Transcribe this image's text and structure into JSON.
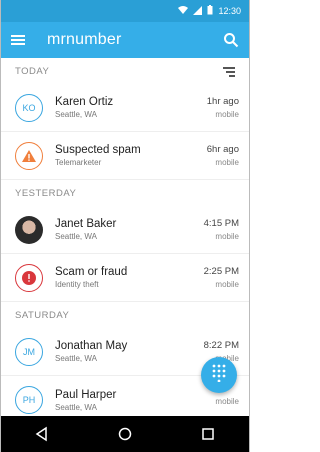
{
  "status": {
    "time": "12:30"
  },
  "appbar": {
    "brand": "mrnumber"
  },
  "sections": {
    "today": "TODAY",
    "yesterday": "YESTERDAY",
    "saturday": "SATURDAY"
  },
  "calls": [
    {
      "initials": "KO",
      "name": "Karen Ortiz",
      "sub": "Seattle, WA",
      "time": "1hr ago",
      "type": "mobile"
    },
    {
      "initials": "",
      "name": "Suspected spam",
      "sub": "Telemarketer",
      "time": "6hr ago",
      "type": "mobile"
    },
    {
      "initials": "",
      "name": "Janet Baker",
      "sub": "Seattle, WA",
      "time": "4:15 PM",
      "type": "mobile"
    },
    {
      "initials": "",
      "name": "Scam or fraud",
      "sub": "Identity theft",
      "time": "2:25 PM",
      "type": "mobile"
    },
    {
      "initials": "JM",
      "name": "Jonathan May",
      "sub": "Seattle, WA",
      "time": "8:22 PM",
      "type": "mobile"
    },
    {
      "initials": "PH",
      "name": "Paul Harper",
      "sub": "Seattle, WA",
      "time": "",
      "type": "mobile"
    }
  ],
  "colors": {
    "appbar": "#35aee8",
    "statusbar": "#2a9fd6",
    "spam": "#f07f3c",
    "fraud": "#d9373c"
  },
  "icons": {
    "menu": "menu-icon",
    "search": "search-icon",
    "sort": "sort-icon",
    "dialpad": "dialpad-icon"
  }
}
